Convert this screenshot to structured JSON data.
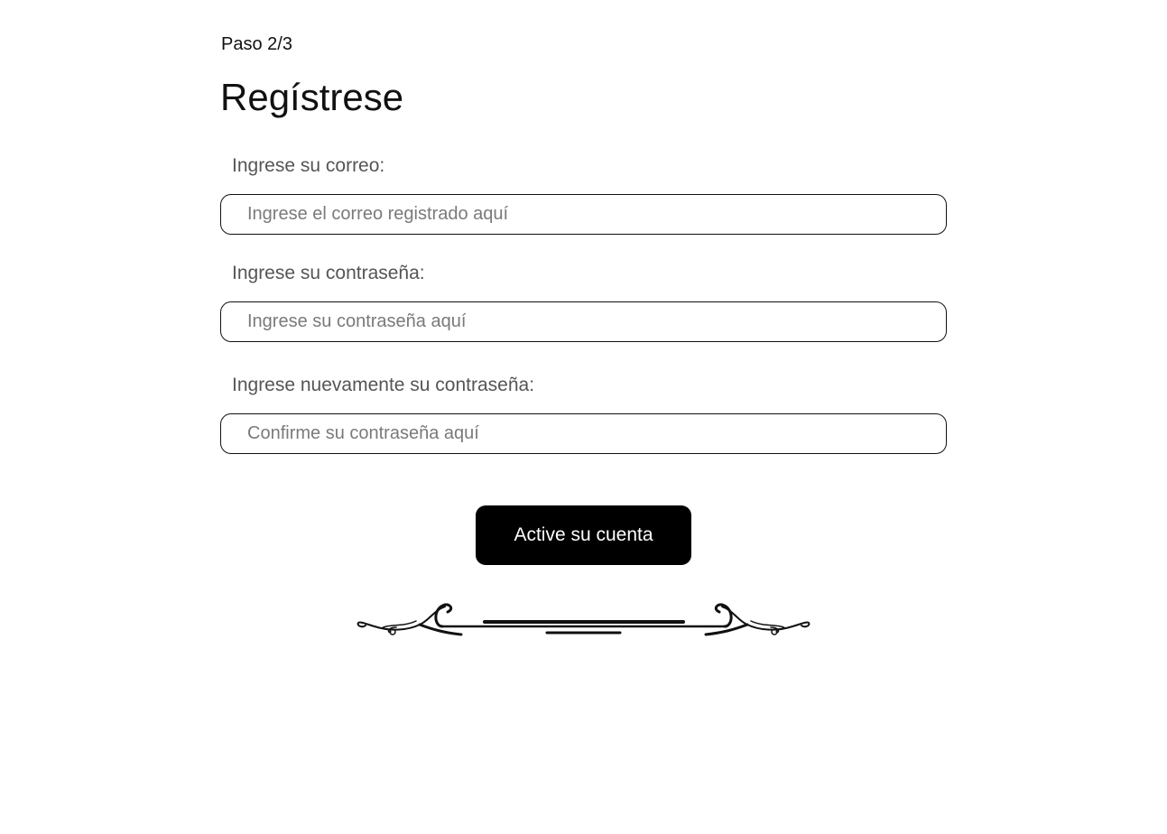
{
  "header": {
    "step": "Paso 2/3",
    "title": "Regístrese"
  },
  "form": {
    "email": {
      "label": "Ingrese su correo:",
      "placeholder": "Ingrese el correo registrado aquí",
      "value": ""
    },
    "password": {
      "label": "Ingrese su contraseña:",
      "placeholder": "Ingrese su contraseña aquí",
      "value": ""
    },
    "confirm_password": {
      "label": "Ingrese nuevamente su contraseña:",
      "placeholder": "Confirme su contraseña aquí",
      "value": ""
    },
    "submit_label": "Active su cuenta"
  },
  "decoration": {
    "icon": "flourish-divider-icon"
  },
  "colors": {
    "background": "#ffffff",
    "button_bg": "#000000",
    "button_text": "#ffffff",
    "label_text": "#555555",
    "placeholder_text": "#7a7a7a",
    "border": "#111111"
  }
}
